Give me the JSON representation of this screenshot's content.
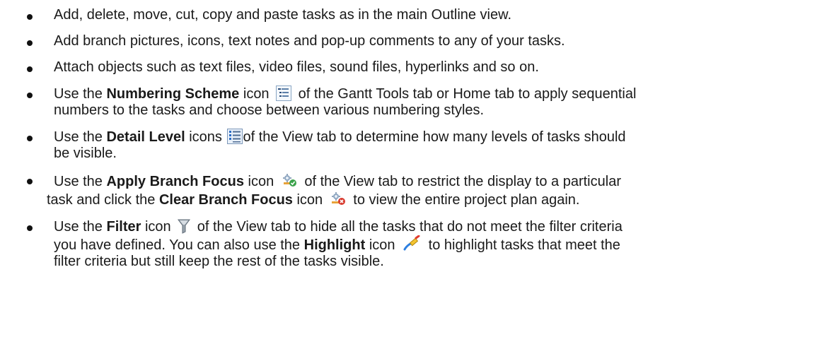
{
  "bullets": [
    {
      "text": "Add, delete, move, cut, copy and paste tasks as in the main Outline view."
    },
    {
      "text": "Add branch pictures, icons, text notes and pop-up comments to any of your tasks."
    },
    {
      "text": "Attach objects such as text files, video files, sound files, hyperlinks and so on."
    },
    {
      "before": "Use the ",
      "bold": "Numbering Scheme",
      "middle": " icon",
      "icon": "numbering-scheme-icon",
      "after": " of the Gantt Tools tab or Home tab to apply sequential",
      "after2": "numbers to the tasks and choose between various numbering styles."
    },
    {
      "before": "Use the ",
      "bold": "Detail Level",
      "middle": " icons",
      "icon": "detail-level-icon",
      "after": "of the View tab to determine how many levels of tasks should",
      "after2": "be visible."
    },
    {
      "before": "Use the ",
      "bold": "Apply Branch Focus",
      "middle": " icon",
      "icon": "apply-branch-focus-icon",
      "after": " of the View tab to restrict the display to a particular",
      "line2_before": "task and click the ",
      "line2_bold": "Clear Branch Focus",
      "line2_middle": " icon",
      "line2_icon": "clear-branch-focus-icon",
      "line2_after": " to view the entire project plan again."
    },
    {
      "before": "Use the ",
      "bold": "Filter",
      "middle": " icon",
      "icon": "filter-icon",
      "after": " of the View tab to hide all the tasks that do not meet the filter criteria",
      "line2_before": "you have defined. You can also use the ",
      "line2_bold": "Highlight",
      "line2_middle": " icon",
      "line2_icon": "highlight-icon",
      "line2_after": " to highlight tasks that meet the",
      "line3": "filter criteria but still keep the rest of the tasks visible."
    }
  ]
}
